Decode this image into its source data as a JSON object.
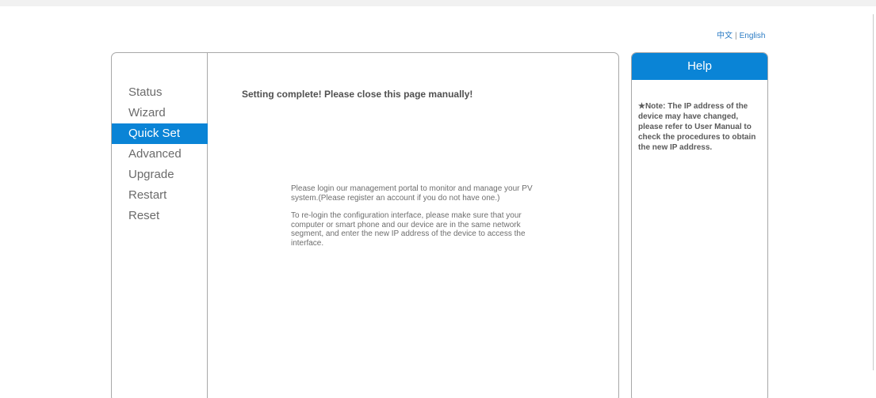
{
  "lang_switch": {
    "chinese": "中文",
    "separator": "|",
    "english": "English"
  },
  "sidebar": {
    "items": [
      {
        "label": "Status",
        "active": false
      },
      {
        "label": "Wizard",
        "active": false
      },
      {
        "label": "Quick Set",
        "active": true
      },
      {
        "label": "Advanced",
        "active": false
      },
      {
        "label": "Upgrade",
        "active": false
      },
      {
        "label": "Restart",
        "active": false
      },
      {
        "label": "Reset",
        "active": false
      }
    ]
  },
  "main": {
    "complete_message": "Setting complete! Please close this page manually!",
    "portal_note": "Please login our management portal to monitor and manage your PV system.(Please register an account if you do not have one.)",
    "relogin_note": "To re-login the configuration interface, please make sure that your computer or smart phone and our device are in the same network segment, and enter the new IP address of the device to access the interface."
  },
  "help": {
    "title": "Help",
    "note": "★Note: The IP address of the device may have changed, please refer to User Manual to check the procedures to obtain the new IP address."
  },
  "colors": {
    "accent": "#0a84d6",
    "link": "#2a7bc4",
    "border": "#a8a8a8"
  }
}
